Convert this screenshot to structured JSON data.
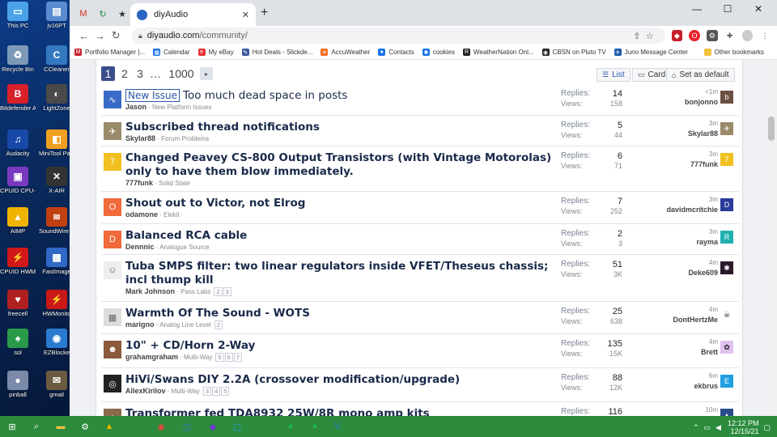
{
  "desktop_icons": [
    {
      "label": "This PC",
      "color": "#4aa3e8",
      "glyph": "▭"
    },
    {
      "label": "jv16PT",
      "color": "#5a8ad0",
      "glyph": "▤"
    },
    {
      "label": "Recycle Bin",
      "color": "#7c99b8",
      "glyph": "♻"
    },
    {
      "label": "CCleaner",
      "color": "#3478c0",
      "glyph": "C"
    },
    {
      "label": "Bitdefender Antivirus Free",
      "color": "#d8202a",
      "glyph": "B"
    },
    {
      "label": "LightZone",
      "color": "#4a4a4a",
      "glyph": "◐"
    },
    {
      "label": "Audacity",
      "color": "#1848a8",
      "glyph": "♫"
    },
    {
      "label": "MiniTool Partitio...",
      "color": "#f0a020",
      "glyph": "◧"
    },
    {
      "label": "CPUID CPU-Z",
      "color": "#7a3ac0",
      "glyph": "▣"
    },
    {
      "label": "X-AIR",
      "color": "#333333",
      "glyph": "✕"
    },
    {
      "label": "AIMP",
      "color": "#f0b400",
      "glyph": "▲"
    },
    {
      "label": "SoundWire Server",
      "color": "#c04010",
      "glyph": "≋"
    },
    {
      "label": "CPUID HWMonitor",
      "color": "#d01818",
      "glyph": "⚡"
    },
    {
      "label": "FastImage",
      "color": "#3068c8",
      "glyph": "▦"
    },
    {
      "label": "freecell",
      "color": "#b02020",
      "glyph": "♥"
    },
    {
      "label": "HWMonito",
      "color": "#c81818",
      "glyph": "⚡"
    },
    {
      "label": "sol",
      "color": "#2a9a4a",
      "glyph": "♠"
    },
    {
      "label": "EZBlocke",
      "color": "#2a7ad0",
      "glyph": "◉"
    },
    {
      "label": "pinball",
      "color": "#7a8aa8",
      "glyph": "●"
    },
    {
      "label": "gmail",
      "color": "#6a5a40",
      "glyph": "✉"
    }
  ],
  "browser": {
    "tab_title": "diyAudio",
    "url_host": "diyaudio.com",
    "url_path": "/community/",
    "new_tab": "+",
    "window_controls": [
      "—",
      "☐",
      "✕"
    ],
    "bookmarks": [
      {
        "label": "Portfolio Manager |...",
        "color": "#c8202a",
        "glyph": "M"
      },
      {
        "label": "Calendar",
        "color": "#1a73e8",
        "glyph": "▦"
      },
      {
        "label": "My eBay",
        "color": "#e53238",
        "glyph": "e"
      },
      {
        "label": "Hot Deals - Slickde...",
        "color": "#3a5a9a",
        "glyph": "✎"
      },
      {
        "label": "AccuWeather",
        "color": "#f26b21",
        "glyph": "☀"
      },
      {
        "label": "Contacts",
        "color": "#1a73e8",
        "glyph": "●"
      },
      {
        "label": "cookies",
        "color": "#1a73e8",
        "glyph": "✱"
      },
      {
        "label": "WeatherNation Onl...",
        "color": "#222222",
        "glyph": "R"
      },
      {
        "label": "CBSN on Pluto TV",
        "color": "#222222",
        "glyph": "◉"
      },
      {
        "label": "Juno Message Center",
        "color": "#1a5aa8",
        "glyph": "✈"
      }
    ],
    "other_bookmarks": "Other bookmarks"
  },
  "pagination": {
    "pages": [
      "1",
      "2",
      "3",
      "…",
      "1000"
    ],
    "current": "1",
    "next": "▸"
  },
  "view": {
    "list": "List",
    "card": "Card",
    "set_default": "Set as default"
  },
  "threads": [
    {
      "prefix": "New Issue",
      "title": "Too much dead space in posts",
      "author": "Jason",
      "forum": "New Platform Issues",
      "pages": [],
      "replies": "14",
      "views": "158",
      "last_time": "<1m",
      "last_user": "bonjonno",
      "avatar_color": "#3a6ac8",
      "avatar_letter": "∿",
      "last_color": "#6a5040",
      "last_letter": "b"
    },
    {
      "prefix": "",
      "title": "Subscribed thread notifications",
      "author": "Skylar88",
      "forum": "Forum Problems",
      "pages": [],
      "replies": "5",
      "views": "44",
      "last_time": "3m",
      "last_user": "Skylar88",
      "avatar_color": "#9a8a6a",
      "avatar_letter": "✈",
      "last_color": "#9a8a6a",
      "last_letter": "✈"
    },
    {
      "prefix": "",
      "title": "Changed Peavey CS-800 Output Transistors (with Vintage Motorolas) only to have them blow immediately.",
      "author": "777funk",
      "forum": "Solid State",
      "pages": [],
      "replies": "6",
      "views": "71",
      "last_time": "3m",
      "last_user": "777funk",
      "avatar_color": "#f0c020",
      "avatar_letter": "7",
      "last_color": "#f0c020",
      "last_letter": "7"
    },
    {
      "prefix": "",
      "title": "Shout out to Victor, not Elrog",
      "author": "odamone",
      "forum": "Elekit",
      "pages": [],
      "replies": "7",
      "views": "252",
      "last_time": "3m",
      "last_user": "davidmcritchie",
      "avatar_color": "#f06a3a",
      "avatar_letter": "O",
      "last_color": "#2a3a9a",
      "last_letter": "D"
    },
    {
      "prefix": "",
      "title": "Balanced RCA cable",
      "author": "Dennnic",
      "forum": "Analogue Source",
      "pages": [],
      "replies": "2",
      "views": "3",
      "last_time": "3m",
      "last_user": "rayma",
      "avatar_color": "#f06a3a",
      "avatar_letter": "D",
      "last_color": "#20b0b0",
      "last_letter": "R"
    },
    {
      "prefix": "",
      "title": "Tuba SMPS filter: two linear regulators inside VFET/Theseus chassis; incl thump kill",
      "author": "Mark Johnson",
      "forum": "Pass Labs",
      "pages": [
        "2",
        "3"
      ],
      "replies": "51",
      "views": "3K",
      "last_time": "4m",
      "last_user": "Deke609",
      "avatar_color": "#eeeeee",
      "avatar_letter": "☺",
      "last_color": "#2a1a2a",
      "last_letter": "✱"
    },
    {
      "prefix": "",
      "title": "Warmth Of The Sound - WOTS",
      "author": "marigno",
      "forum": "Analog Line Level",
      "pages": [
        "2"
      ],
      "replies": "25",
      "views": "638",
      "last_time": "4m",
      "last_user": "DontHertzMe",
      "avatar_color": "#dddddd",
      "avatar_letter": "▦",
      "last_color": "#ffffff",
      "last_letter": "☠"
    },
    {
      "prefix": "",
      "title": "10\" + CD/Horn 2-Way",
      "author": "grahamgraham",
      "forum": "Multi-Way",
      "pages": [
        "5",
        "6",
        "7"
      ],
      "replies": "135",
      "views": "15K",
      "last_time": "4m",
      "last_user": "Brett",
      "avatar_color": "#8a5a3a",
      "avatar_letter": "☻",
      "last_color": "#e0c0f0",
      "last_letter": "✿"
    },
    {
      "prefix": "",
      "title": "HiVi/Swans DIY 2.2A (crossover modification/upgrade)",
      "author": "AllexKirilov",
      "forum": "Multi-Way",
      "pages": [
        "3",
        "4",
        "5"
      ],
      "replies": "88",
      "views": "12K",
      "last_time": "6m",
      "last_user": "ekbrus",
      "avatar_color": "#222222",
      "avatar_letter": "◎",
      "last_color": "#20a0e0",
      "last_letter": "E"
    },
    {
      "prefix": "",
      "title": "Transformer fed TDA8932 25W/8R mono amp kits",
      "author": "",
      "forum": "",
      "pages": [],
      "replies": "116",
      "views": "",
      "last_time": "10m",
      "last_user": "",
      "avatar_color": "#8a6a4a",
      "avatar_letter": "▲",
      "last_color": "#2a4a8a",
      "last_letter": "▲"
    }
  ],
  "labels": {
    "replies": "Replies:",
    "views": "Views:"
  },
  "taskbar": {
    "time": "12:12 PM",
    "date": "12/15/21",
    "apps": [
      {
        "glyph": "⊞",
        "color": "#ffffff"
      },
      {
        "glyph": "⌕",
        "color": "#ffffff"
      },
      {
        "glyph": "▬",
        "color": "#f0c040"
      },
      {
        "glyph": "⚙",
        "color": "#ffffff"
      },
      {
        "glyph": "▲",
        "color": "#f0b400"
      },
      {
        "glyph": "◉",
        "color": "#e84a3a"
      },
      {
        "glyph": "◫",
        "color": "#3a7ad0"
      },
      {
        "glyph": "◆",
        "color": "#6a3ad0"
      },
      {
        "glyph": "▢",
        "color": "#2a9aea"
      },
      {
        "glyph": "●",
        "color": "#1db954"
      },
      {
        "glyph": "●",
        "color": "#1db954"
      },
      {
        "glyph": "V",
        "color": "#2a7ad0"
      }
    ]
  }
}
